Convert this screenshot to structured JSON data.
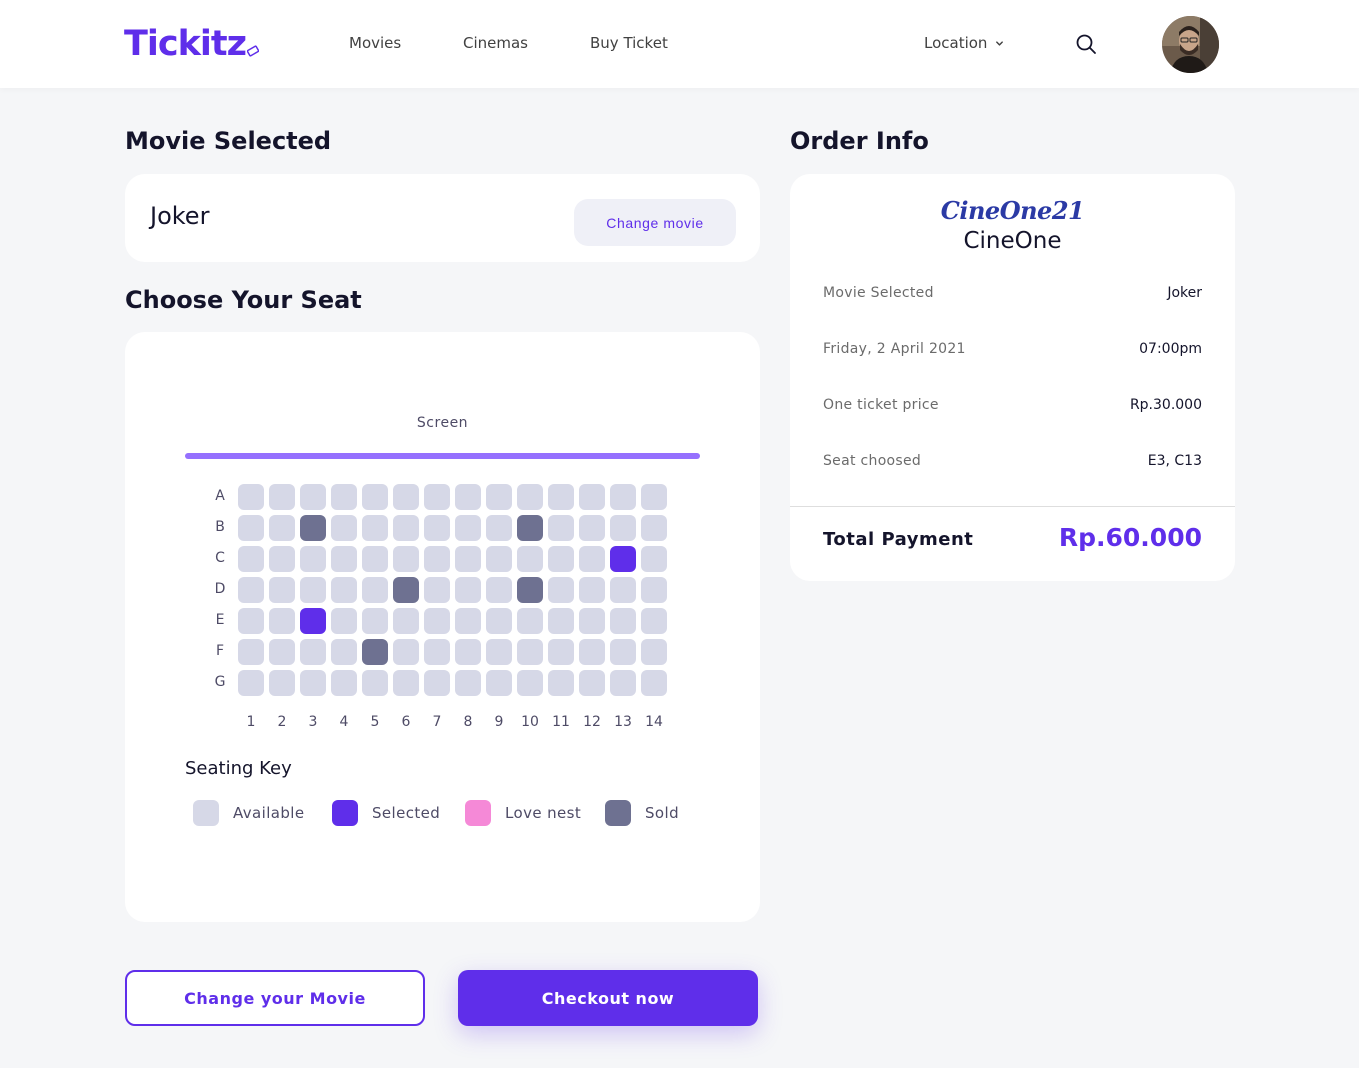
{
  "brand": {
    "name": "Tickitz",
    "color": "#5f2eea"
  },
  "nav": {
    "links": [
      "Movies",
      "Cinemas",
      "Buy Ticket"
    ],
    "location": "Location",
    "search_icon": "search-icon",
    "avatar": "user-avatar"
  },
  "movie_section": {
    "title": "Movie Selected",
    "movie_name": "Joker",
    "change_button": "Change movie"
  },
  "seat_section": {
    "title": "Choose Your Seat",
    "screen_label": "Screen",
    "rows": [
      "A",
      "B",
      "C",
      "D",
      "E",
      "F",
      "G"
    ],
    "columns": [
      "1",
      "2",
      "3",
      "4",
      "5",
      "6",
      "7",
      "8",
      "9",
      "10",
      "11",
      "12",
      "13",
      "14"
    ],
    "sold_seats": [
      "B3",
      "B10",
      "D6",
      "D10",
      "F5"
    ],
    "selected_seats": [
      "C13",
      "E3"
    ],
    "key_title": "Seating Key",
    "key": [
      {
        "label": "Available",
        "color": "#d6d8e7"
      },
      {
        "label": "Selected",
        "color": "#5f2eea"
      },
      {
        "label": "Love nest",
        "color": "#f589d7"
      },
      {
        "label": "Sold",
        "color": "#6e7191"
      }
    ]
  },
  "order_info": {
    "title": "Order Info",
    "cinema_logo": "CineOne21",
    "cinema_name": "CineOne",
    "rows": [
      {
        "label": "Movie Selected",
        "value": "Joker"
      },
      {
        "label": "Friday, 2 April 2021",
        "value": "07:00pm"
      },
      {
        "label": "One ticket price",
        "value": "Rp.30.000"
      },
      {
        "label": "Seat choosed",
        "value": "E3, C13"
      }
    ],
    "total_label": "Total Payment",
    "total_value": "Rp.60.000"
  },
  "actions": {
    "change_movie": "Change your Movie",
    "checkout": "Checkout now"
  }
}
